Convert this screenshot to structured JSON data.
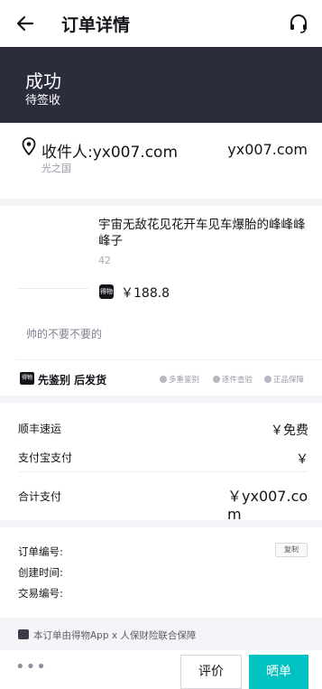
{
  "header": {
    "title": "订单详情",
    "back_icon": "back-arrow-icon",
    "service_icon": "headset-icon"
  },
  "status": {
    "title": "成功",
    "subtitle": "待签收",
    "bg_color": "#2b2c3c"
  },
  "address": {
    "name": "收件人:yx007.com",
    "phone": "yx007.com",
    "detail": "光之国"
  },
  "product": {
    "title": "宇宙无敌花见花开车见车爆胎的峰峰峰峰子",
    "size": "42",
    "brand_badge": "得物",
    "price": "￥188.8",
    "remark": "帅的不要不要的",
    "service_badge": "得物",
    "service_label": "先鉴别 后发货",
    "tags": [
      "多重鉴别",
      "逐件查验",
      "正品保障"
    ]
  },
  "payment": {
    "shipping_label": "顺丰速运",
    "shipping_value": "￥免费",
    "method_label": "支付宝支付",
    "method_value": "￥",
    "total_label": "合计支付",
    "total_value": "￥yx007.com"
  },
  "order_info": {
    "order_no_label": "订单编号:",
    "copy_label": "复制",
    "created_label": "创建时间:",
    "trade_no_label": "交易编号:"
  },
  "insurance": {
    "text": "本订单由得物App x 人保财险联合保障"
  },
  "bottom_bar": {
    "more": "•••",
    "rate_label": "评价",
    "share_label": "晒单",
    "accent_color": "#01c2c3"
  }
}
